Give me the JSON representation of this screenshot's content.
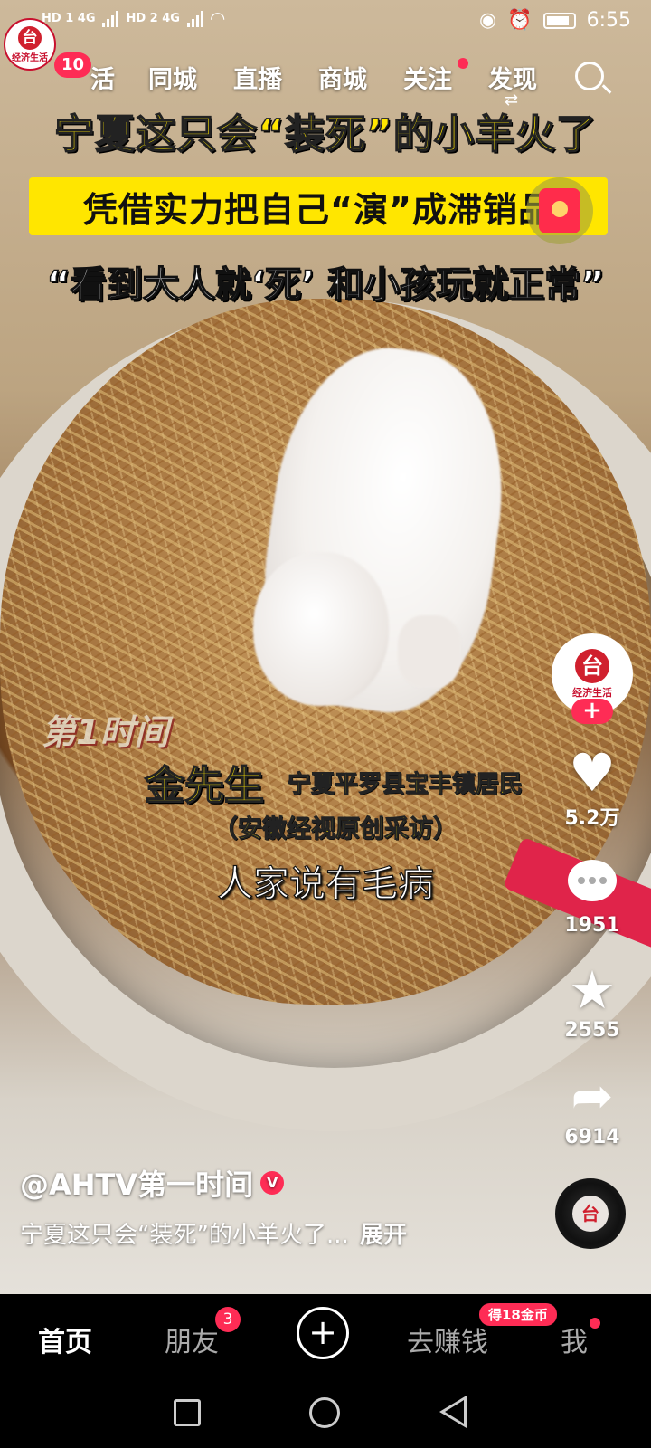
{
  "status_bar": {
    "network_1": "HD 1 4G",
    "network_2": "HD 2 4G",
    "icons": [
      "eye-icon",
      "alarm-icon",
      "battery-icon"
    ],
    "time": "6:55"
  },
  "top_nav": {
    "channel_logo_text": "经济生活",
    "notification_count": "10",
    "tabs": [
      "活",
      "同城",
      "直播",
      "商城",
      "关注",
      "发现"
    ],
    "search_icon": "search-icon"
  },
  "video": {
    "title_line1": "宁夏这只会“装死”的小羊火了",
    "title_line2": "凭借实力把自己“演”成滞销品",
    "title_line3": "“看到大人就‘死’ 和小孩玩就正常”",
    "program_logo": "第1时间",
    "speaker_name": "金先生",
    "speaker_role": "宁夏平罗县宝丰镇居民",
    "source_note": "（安徽经视原创采访）",
    "subtitle": "人家说有毛病"
  },
  "actions": {
    "avatar_text": "经济生活",
    "follow_symbol": "+",
    "likes": "5.2万",
    "comments": "1951",
    "favorites": "2555",
    "shares": "6914"
  },
  "post": {
    "author": "@AHTV第一时间",
    "description": "宁夏这只会“装死”的小羊火了...",
    "expand_label": "展开"
  },
  "bottom_tabs": {
    "home": "首页",
    "friends": "朋友",
    "friends_badge": "3",
    "create": "+",
    "earn": "去赚钱",
    "earn_badge": "得18金币",
    "me": "我"
  },
  "colors": {
    "accent": "#fe2c55",
    "caption_yellow": "#ffe600"
  }
}
